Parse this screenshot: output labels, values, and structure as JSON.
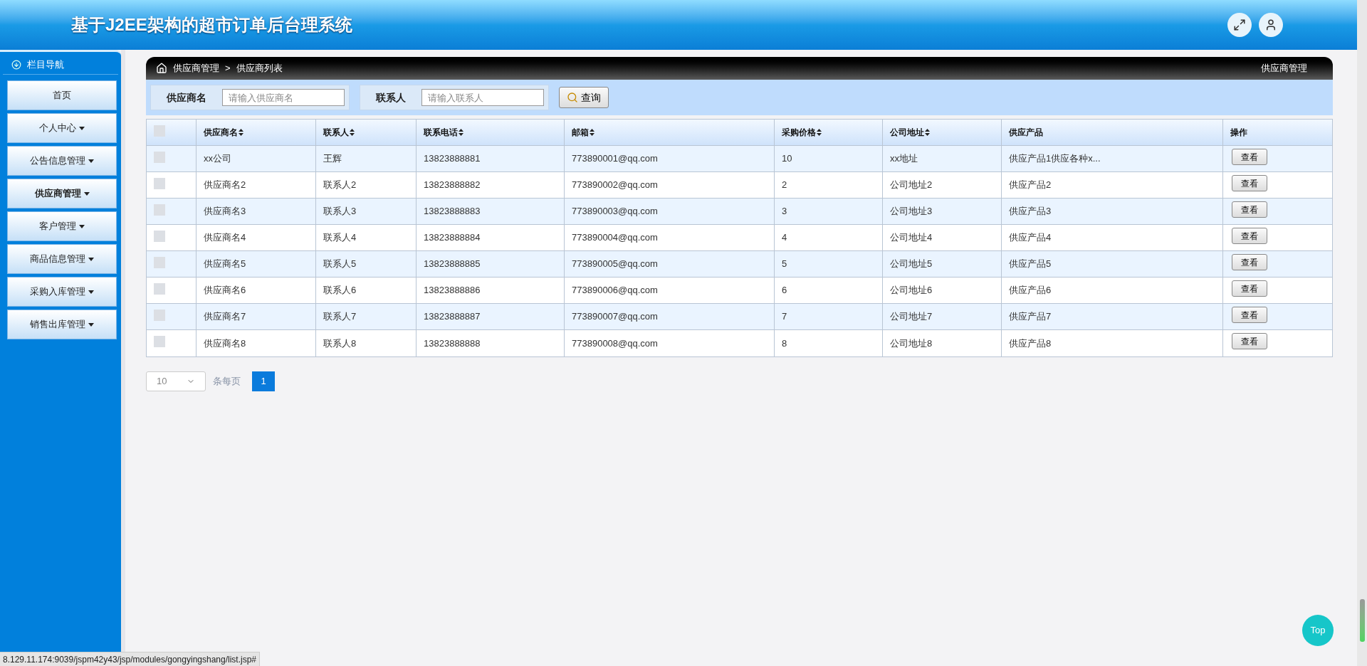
{
  "header": {
    "title": "基于J2EE架构的超市订单后台理系统"
  },
  "sidebar": {
    "title": "栏目导航",
    "items": [
      {
        "label": "首页",
        "has_menu": false,
        "selected": false
      },
      {
        "label": "个人中心",
        "has_menu": true,
        "selected": false
      },
      {
        "label": "公告信息管理",
        "has_menu": true,
        "selected": false
      },
      {
        "label": "供应商管理",
        "has_menu": true,
        "selected": true
      },
      {
        "label": "客户管理",
        "has_menu": true,
        "selected": false
      },
      {
        "label": "商品信息管理",
        "has_menu": true,
        "selected": false
      },
      {
        "label": "采购入库管理",
        "has_menu": true,
        "selected": false
      },
      {
        "label": "销售出库管理",
        "has_menu": true,
        "selected": false
      }
    ]
  },
  "breadcrumb": {
    "items": [
      "供应商管理",
      "供应商列表"
    ],
    "separator": ">",
    "right_title": "供应商管理"
  },
  "search": {
    "fields": [
      {
        "label": "供应商名",
        "placeholder": "请输入供应商名"
      },
      {
        "label": "联系人",
        "placeholder": "请输入联系人"
      }
    ],
    "button": "查询"
  },
  "table": {
    "header_checked": false,
    "columns": [
      {
        "label": "供应商名",
        "sortable": true
      },
      {
        "label": "联系人",
        "sortable": true
      },
      {
        "label": "联系电话",
        "sortable": true
      },
      {
        "label": "邮箱",
        "sortable": true
      },
      {
        "label": "采购价格",
        "sortable": true
      },
      {
        "label": "公司地址",
        "sortable": true
      },
      {
        "label": "供应产品",
        "sortable": false
      },
      {
        "label": "操作",
        "sortable": false
      }
    ],
    "rows": [
      {
        "checked": false,
        "cells": [
          "xx公司",
          "王辉",
          "13823888881",
          "773890001@qq.com",
          "10",
          "xx地址",
          "供应产品1供应各种x..."
        ],
        "action": "查看"
      },
      {
        "checked": false,
        "cells": [
          "供应商名2",
          "联系人2",
          "13823888882",
          "773890002@qq.com",
          "2",
          "公司地址2",
          "供应产品2"
        ],
        "action": "查看"
      },
      {
        "checked": false,
        "cells": [
          "供应商名3",
          "联系人3",
          "13823888883",
          "773890003@qq.com",
          "3",
          "公司地址3",
          "供应产品3"
        ],
        "action": "查看"
      },
      {
        "checked": false,
        "cells": [
          "供应商名4",
          "联系人4",
          "13823888884",
          "773890004@qq.com",
          "4",
          "公司地址4",
          "供应产品4"
        ],
        "action": "查看"
      },
      {
        "checked": false,
        "cells": [
          "供应商名5",
          "联系人5",
          "13823888885",
          "773890005@qq.com",
          "5",
          "公司地址5",
          "供应产品5"
        ],
        "action": "查看"
      },
      {
        "checked": false,
        "cells": [
          "供应商名6",
          "联系人6",
          "13823888886",
          "773890006@qq.com",
          "6",
          "公司地址6",
          "供应产品6"
        ],
        "action": "查看"
      },
      {
        "checked": false,
        "cells": [
          "供应商名7",
          "联系人7",
          "13823888887",
          "773890007@qq.com",
          "7",
          "公司地址7",
          "供应产品7"
        ],
        "action": "查看"
      },
      {
        "checked": false,
        "cells": [
          "供应商名8",
          "联系人8",
          "13823888888",
          "773890008@qq.com",
          "8",
          "公司地址8",
          "供应产品8"
        ],
        "action": "查看"
      }
    ]
  },
  "pagination": {
    "page_size": "10",
    "page_size_label": "条每页",
    "pages": [
      {
        "label": "1",
        "selected": true
      }
    ]
  },
  "top_button": "Top",
  "status_bar": "8.129.11.174:9039/jspm42y43/jsp/modules/gongyingshang/list.jsp#"
}
